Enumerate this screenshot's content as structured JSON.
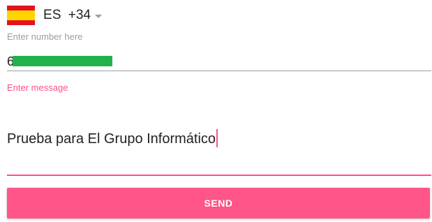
{
  "country_selector": {
    "flag_icon": "spain-flag-icon",
    "country_code": "ES",
    "dial_code": "+34",
    "dropdown_icon": "caret-down-icon",
    "flag_colors": {
      "red": "#e3121b",
      "yellow": "#ffd500"
    }
  },
  "number_field": {
    "label": "Enter number here",
    "value_visible_prefix": "6",
    "redacted": true,
    "redaction_color": "#22b24c"
  },
  "message_field": {
    "label": "Enter message",
    "value": "Prueba para El Grupo Informático",
    "focused": true
  },
  "send_button": {
    "label": "SEND"
  },
  "colors": {
    "accent": "#ff4f86",
    "button": "#ff5589",
    "hint": "#9e9e9e"
  }
}
